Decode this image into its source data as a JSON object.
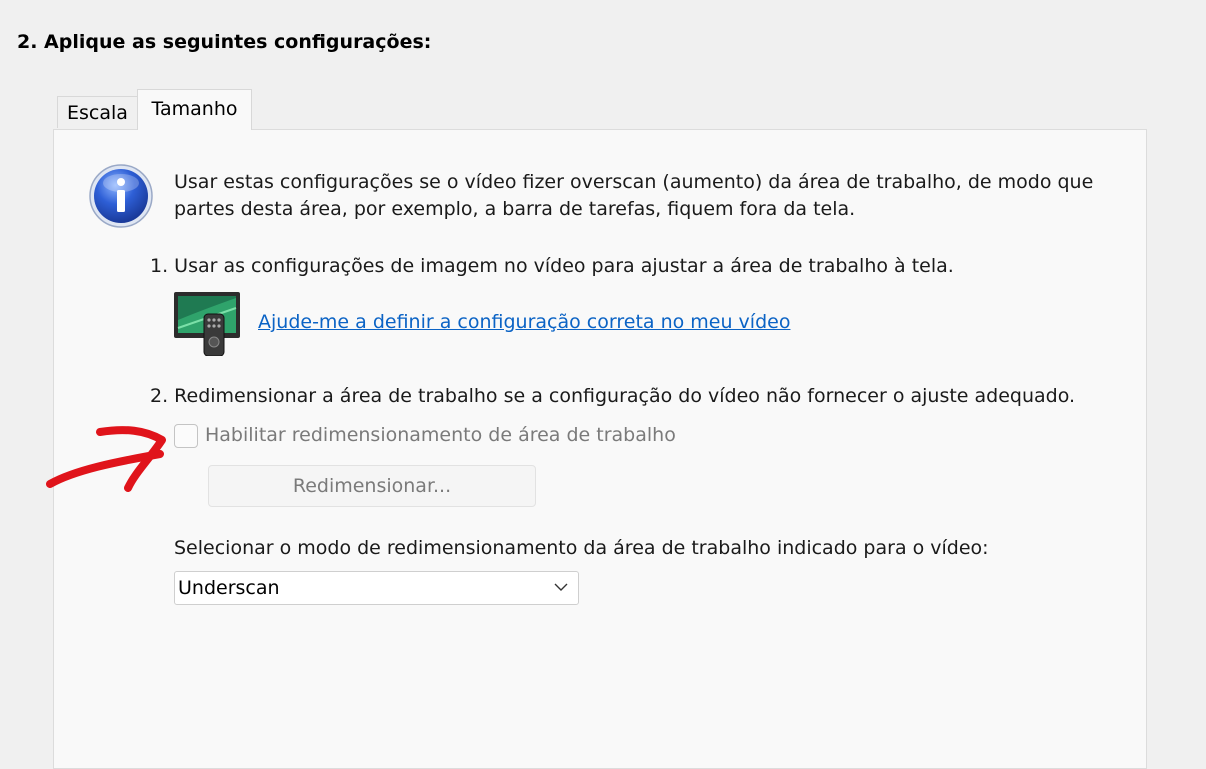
{
  "step_heading": "2. Aplique as seguintes configurações:",
  "tabs": [
    {
      "label": "Escala"
    },
    {
      "label": "Tamanho",
      "selected": true
    }
  ],
  "info": {
    "icon": "info-icon",
    "text": "Usar estas configurações se o vídeo fizer overscan (aumento) da área de trabalho, de modo que partes desta área, por exemplo, a barra de tarefas, fiquem fora da tela."
  },
  "option1": {
    "text": "1. Usar as configurações de imagem no vídeo para ajustar a área de trabalho à tela.",
    "link": "Ajude-me a definir a configuração correta no meu vídeo"
  },
  "option2": {
    "text": "2. Redimensionar a área de trabalho se a configuração do vídeo não fornecer o ajuste adequado.",
    "checkbox_label": "Habilitar redimensionamento de área de trabalho",
    "checkbox_checked": false,
    "button_label": "Redimensionar..."
  },
  "mode": {
    "label": "Selecionar o modo de redimensionamento da área de trabalho indicado para o vídeo:",
    "selected": "Underscan"
  },
  "colors": {
    "link": "#0b63c5",
    "annotation": "#e0141b",
    "disabled_text": "#7a7a7a"
  }
}
